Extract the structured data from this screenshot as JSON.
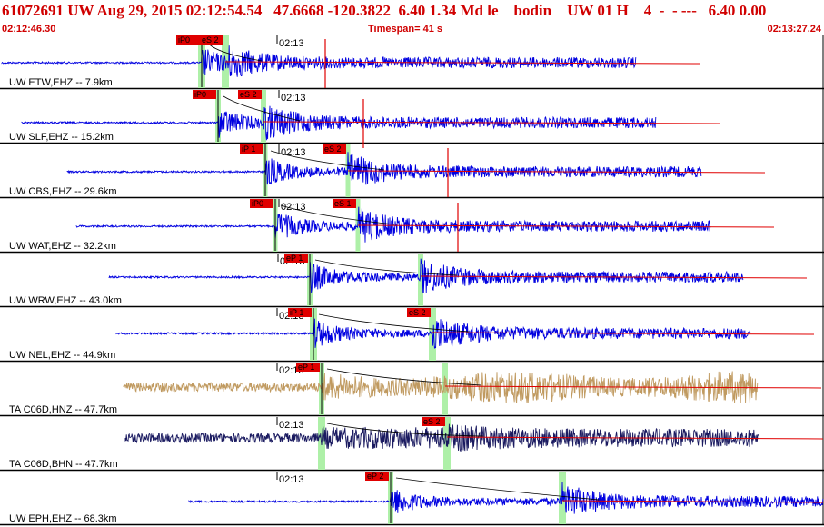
{
  "header": {
    "title": "61072691 UW Aug 29, 2015 02:12:54.54   47.6668 -120.3822  6.40 1.34 Md le    bodin    UW 01 H    4  -  - ---   6.40 0.00",
    "start_time": "02:12:46.30",
    "timespan": "Timespan=  41 s",
    "end_time": "02:13:27.24"
  },
  "tick_label": "02:13",
  "colors": {
    "header_red": "#d00000",
    "trace_blue": "#0000e0",
    "trace_tan": "#c09a60",
    "trace_navy": "#1a1a60",
    "pick_red": "#e00000",
    "phase_window_green": "#aef0a8",
    "separator": "#000000"
  },
  "channels": [
    {
      "label": "UW ETW,EHZ -- 7.9km",
      "color": "blue",
      "p_pick": "iP0",
      "s_pick": "eS 2"
    },
    {
      "label": "UW SLF,EHZ -- 15.2km",
      "color": "blue",
      "p_pick": "iP0",
      "s_pick": "eS 2"
    },
    {
      "label": "UW CBS,EHZ -- 29.6km",
      "color": "blue",
      "p_pick": "iP 1",
      "s_pick": "eS 2"
    },
    {
      "label": "UW WAT,EHZ -- 32.2km",
      "color": "blue",
      "p_pick": "iP0",
      "s_pick": "eS 1"
    },
    {
      "label": "UW WRW,EHZ -- 43.0km",
      "color": "blue",
      "p_pick": "eP 1",
      "s_pick": ""
    },
    {
      "label": "UW NEL,EHZ -- 44.9km",
      "color": "blue",
      "p_pick": "iP 1",
      "s_pick": "eS 2"
    },
    {
      "label": "TA C06D,HNZ -- 47.7km",
      "color": "tan",
      "p_pick": "eP 1",
      "s_pick": ""
    },
    {
      "label": "TA C06D,BHN -- 47.7km",
      "color": "navy",
      "p_pick": "",
      "s_pick": "eS 2"
    },
    {
      "label": "UW EPH,EHZ -- 68.3km",
      "color": "blue",
      "p_pick": "eP 2",
      "s_pick": ""
    }
  ]
}
